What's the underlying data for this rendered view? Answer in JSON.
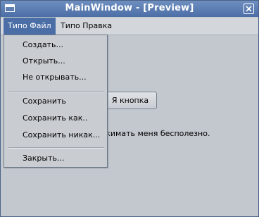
{
  "window": {
    "title": "MainWindow - [Preview]"
  },
  "menubar": {
    "items": [
      {
        "label": "Типо Файл",
        "active": true
      },
      {
        "label": "Типо Правка",
        "active": false
      }
    ]
  },
  "file_menu": {
    "items": [
      {
        "label": "Создать..."
      },
      {
        "label": "Открыть..."
      },
      {
        "label": "Не открывать..."
      },
      {
        "label": "Сохранить"
      },
      {
        "label": "Сохранить как.."
      },
      {
        "label": "Сохранить никак..."
      },
      {
        "label": "Закрыть..."
      }
    ]
  },
  "content": {
    "button_label": "Я кнопка",
    "label_visible_text": "жимать меня бесполезно."
  },
  "colors": {
    "titlebar": "#4b6ea6",
    "menu_highlight": "#4b6ea6",
    "background": "#c3c8cf"
  }
}
